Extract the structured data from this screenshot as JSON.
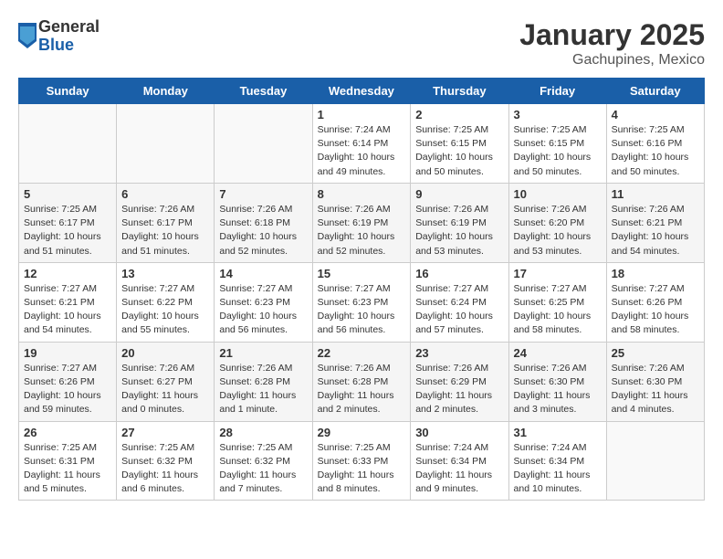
{
  "header": {
    "logo_general": "General",
    "logo_blue": "Blue",
    "month_title": "January 2025",
    "location": "Gachupines, Mexico"
  },
  "weekdays": [
    "Sunday",
    "Monday",
    "Tuesday",
    "Wednesday",
    "Thursday",
    "Friday",
    "Saturday"
  ],
  "weeks": [
    [
      {
        "day": "",
        "info": ""
      },
      {
        "day": "",
        "info": ""
      },
      {
        "day": "",
        "info": ""
      },
      {
        "day": "1",
        "info": "Sunrise: 7:24 AM\nSunset: 6:14 PM\nDaylight: 10 hours\nand 49 minutes."
      },
      {
        "day": "2",
        "info": "Sunrise: 7:25 AM\nSunset: 6:15 PM\nDaylight: 10 hours\nand 50 minutes."
      },
      {
        "day": "3",
        "info": "Sunrise: 7:25 AM\nSunset: 6:15 PM\nDaylight: 10 hours\nand 50 minutes."
      },
      {
        "day": "4",
        "info": "Sunrise: 7:25 AM\nSunset: 6:16 PM\nDaylight: 10 hours\nand 50 minutes."
      }
    ],
    [
      {
        "day": "5",
        "info": "Sunrise: 7:25 AM\nSunset: 6:17 PM\nDaylight: 10 hours\nand 51 minutes."
      },
      {
        "day": "6",
        "info": "Sunrise: 7:26 AM\nSunset: 6:17 PM\nDaylight: 10 hours\nand 51 minutes."
      },
      {
        "day": "7",
        "info": "Sunrise: 7:26 AM\nSunset: 6:18 PM\nDaylight: 10 hours\nand 52 minutes."
      },
      {
        "day": "8",
        "info": "Sunrise: 7:26 AM\nSunset: 6:19 PM\nDaylight: 10 hours\nand 52 minutes."
      },
      {
        "day": "9",
        "info": "Sunrise: 7:26 AM\nSunset: 6:19 PM\nDaylight: 10 hours\nand 53 minutes."
      },
      {
        "day": "10",
        "info": "Sunrise: 7:26 AM\nSunset: 6:20 PM\nDaylight: 10 hours\nand 53 minutes."
      },
      {
        "day": "11",
        "info": "Sunrise: 7:26 AM\nSunset: 6:21 PM\nDaylight: 10 hours\nand 54 minutes."
      }
    ],
    [
      {
        "day": "12",
        "info": "Sunrise: 7:27 AM\nSunset: 6:21 PM\nDaylight: 10 hours\nand 54 minutes."
      },
      {
        "day": "13",
        "info": "Sunrise: 7:27 AM\nSunset: 6:22 PM\nDaylight: 10 hours\nand 55 minutes."
      },
      {
        "day": "14",
        "info": "Sunrise: 7:27 AM\nSunset: 6:23 PM\nDaylight: 10 hours\nand 56 minutes."
      },
      {
        "day": "15",
        "info": "Sunrise: 7:27 AM\nSunset: 6:23 PM\nDaylight: 10 hours\nand 56 minutes."
      },
      {
        "day": "16",
        "info": "Sunrise: 7:27 AM\nSunset: 6:24 PM\nDaylight: 10 hours\nand 57 minutes."
      },
      {
        "day": "17",
        "info": "Sunrise: 7:27 AM\nSunset: 6:25 PM\nDaylight: 10 hours\nand 58 minutes."
      },
      {
        "day": "18",
        "info": "Sunrise: 7:27 AM\nSunset: 6:26 PM\nDaylight: 10 hours\nand 58 minutes."
      }
    ],
    [
      {
        "day": "19",
        "info": "Sunrise: 7:27 AM\nSunset: 6:26 PM\nDaylight: 10 hours\nand 59 minutes."
      },
      {
        "day": "20",
        "info": "Sunrise: 7:26 AM\nSunset: 6:27 PM\nDaylight: 11 hours\nand 0 minutes."
      },
      {
        "day": "21",
        "info": "Sunrise: 7:26 AM\nSunset: 6:28 PM\nDaylight: 11 hours\nand 1 minute."
      },
      {
        "day": "22",
        "info": "Sunrise: 7:26 AM\nSunset: 6:28 PM\nDaylight: 11 hours\nand 2 minutes."
      },
      {
        "day": "23",
        "info": "Sunrise: 7:26 AM\nSunset: 6:29 PM\nDaylight: 11 hours\nand 2 minutes."
      },
      {
        "day": "24",
        "info": "Sunrise: 7:26 AM\nSunset: 6:30 PM\nDaylight: 11 hours\nand 3 minutes."
      },
      {
        "day": "25",
        "info": "Sunrise: 7:26 AM\nSunset: 6:30 PM\nDaylight: 11 hours\nand 4 minutes."
      }
    ],
    [
      {
        "day": "26",
        "info": "Sunrise: 7:25 AM\nSunset: 6:31 PM\nDaylight: 11 hours\nand 5 minutes."
      },
      {
        "day": "27",
        "info": "Sunrise: 7:25 AM\nSunset: 6:32 PM\nDaylight: 11 hours\nand 6 minutes."
      },
      {
        "day": "28",
        "info": "Sunrise: 7:25 AM\nSunset: 6:32 PM\nDaylight: 11 hours\nand 7 minutes."
      },
      {
        "day": "29",
        "info": "Sunrise: 7:25 AM\nSunset: 6:33 PM\nDaylight: 11 hours\nand 8 minutes."
      },
      {
        "day": "30",
        "info": "Sunrise: 7:24 AM\nSunset: 6:34 PM\nDaylight: 11 hours\nand 9 minutes."
      },
      {
        "day": "31",
        "info": "Sunrise: 7:24 AM\nSunset: 6:34 PM\nDaylight: 11 hours\nand 10 minutes."
      },
      {
        "day": "",
        "info": ""
      }
    ]
  ]
}
